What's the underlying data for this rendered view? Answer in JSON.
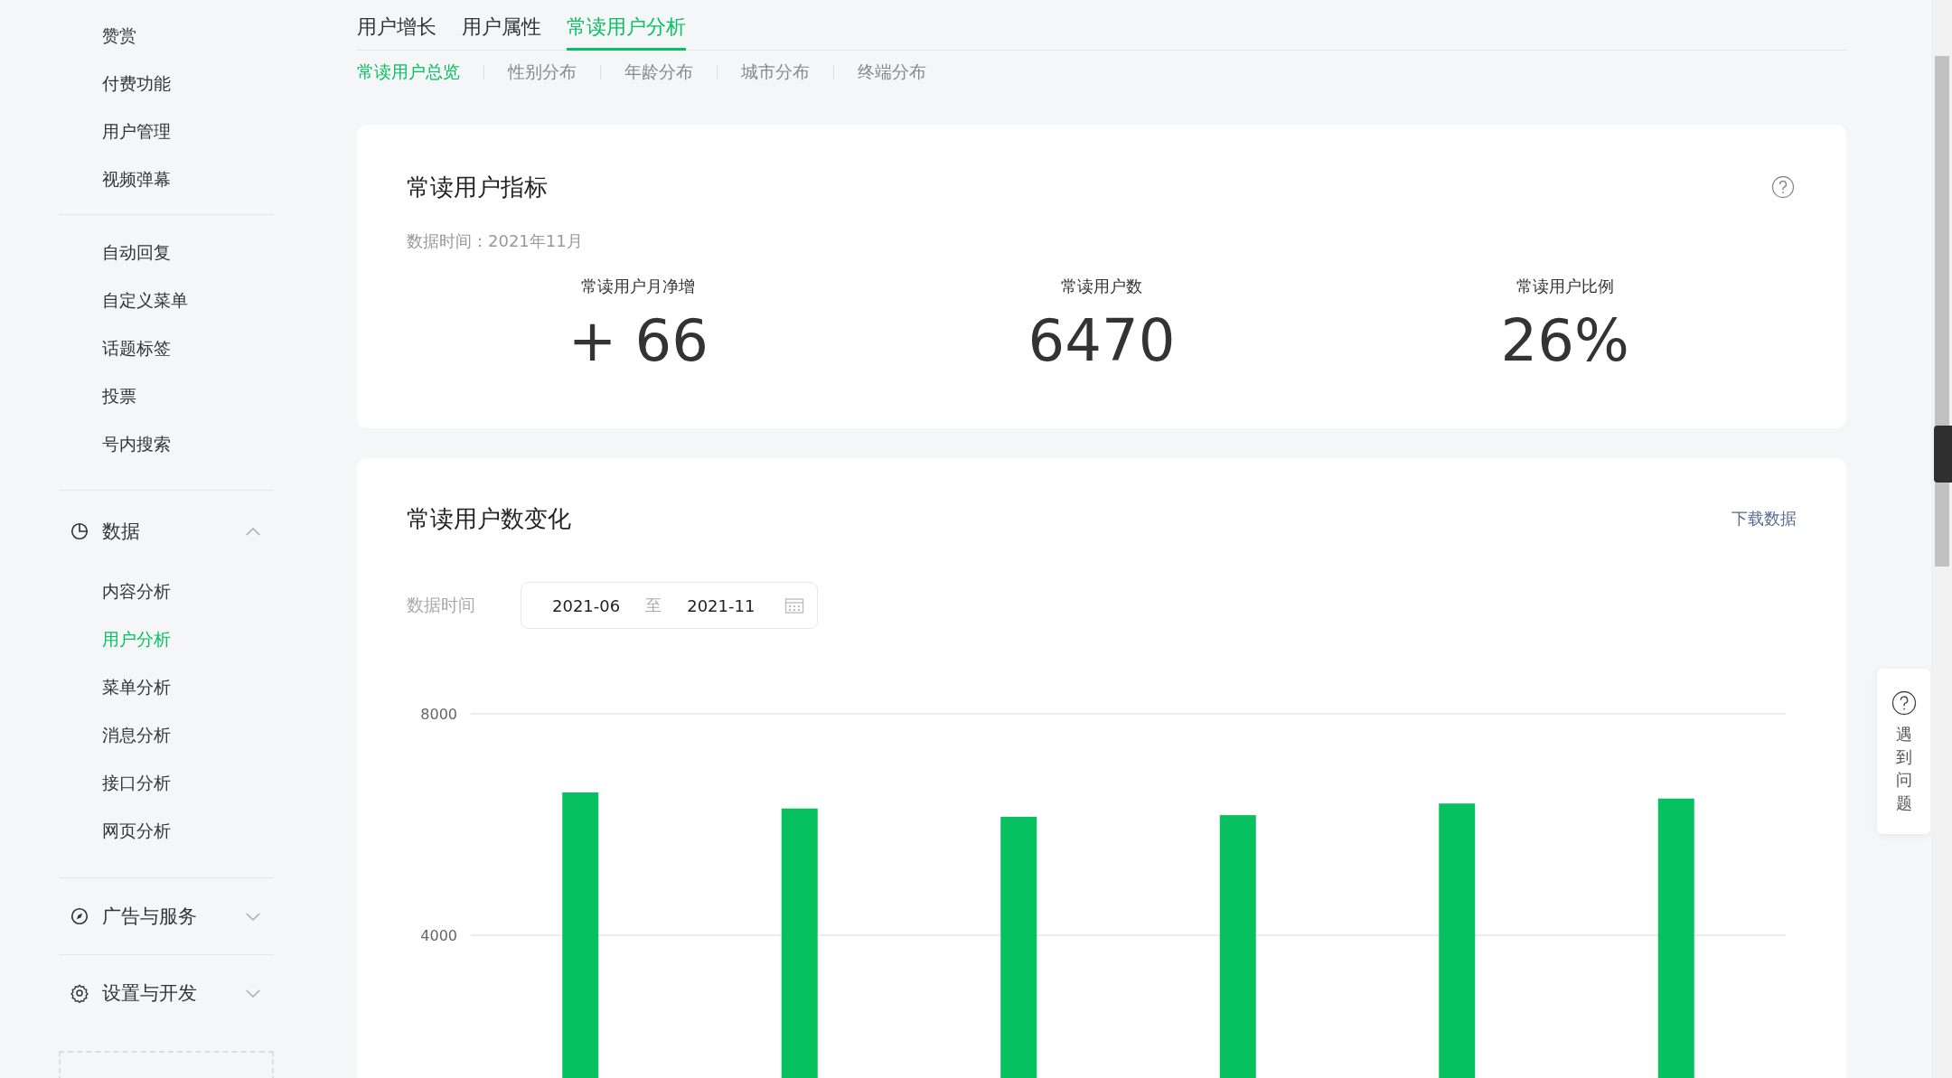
{
  "sidebar": {
    "sections": [
      {
        "items": [
          {
            "label": "赞赏",
            "selected": false
          },
          {
            "label": "付费功能",
            "selected": false
          },
          {
            "label": "用户管理",
            "selected": false
          },
          {
            "label": "视频弹幕",
            "selected": false
          }
        ]
      },
      {
        "items": [
          {
            "label": "自动回复",
            "selected": false
          },
          {
            "label": "自定义菜单",
            "selected": false
          },
          {
            "label": "话题标签",
            "selected": false
          },
          {
            "label": "投票",
            "selected": false
          },
          {
            "label": "号内搜索",
            "selected": false
          }
        ]
      },
      {
        "title": "数据",
        "expanded": true,
        "items": [
          {
            "label": "内容分析",
            "selected": false
          },
          {
            "label": "用户分析",
            "selected": true
          },
          {
            "label": "菜单分析",
            "selected": false
          },
          {
            "label": "消息分析",
            "selected": false
          },
          {
            "label": "接口分析",
            "selected": false
          },
          {
            "label": "网页分析",
            "selected": false
          }
        ]
      },
      {
        "title": "广告与服务",
        "expanded": false
      },
      {
        "title": "设置与开发",
        "expanded": false
      }
    ]
  },
  "tabs": [
    {
      "label": "用户增长",
      "selected": false
    },
    {
      "label": "用户属性",
      "selected": false
    },
    {
      "label": "常读用户分析",
      "selected": true
    }
  ],
  "subtabs": [
    {
      "label": "常读用户总览",
      "selected": true
    },
    {
      "label": "性别分布",
      "selected": false
    },
    {
      "label": "年龄分布",
      "selected": false
    },
    {
      "label": "城市分布",
      "selected": false
    },
    {
      "label": "终端分布",
      "selected": false
    }
  ],
  "metrics_card": {
    "title": "常读用户指标",
    "data_time": "数据时间：2021年11月",
    "metrics": [
      {
        "label": "常读用户月净增",
        "value": "+ 66"
      },
      {
        "label": "常读用户数",
        "value": "6470"
      },
      {
        "label": "常读用户比例",
        "value": "26%"
      }
    ]
  },
  "trend_card": {
    "title": "常读用户数变化",
    "download": "下载数据",
    "date_label": "数据时间",
    "date_from": "2021-06",
    "date_sep": "至",
    "date_to": "2021-11",
    "chart_data": {
      "type": "bar",
      "ylim": [
        1306,
        8000
      ],
      "yticks": [
        4000,
        8000
      ],
      "series": [
        {
          "color": "#07c160",
          "values": [
            6580,
            6290,
            6140,
            6170,
            6380,
            6470
          ]
        }
      ]
    }
  },
  "help_widget": {
    "label": "遇到问题"
  }
}
